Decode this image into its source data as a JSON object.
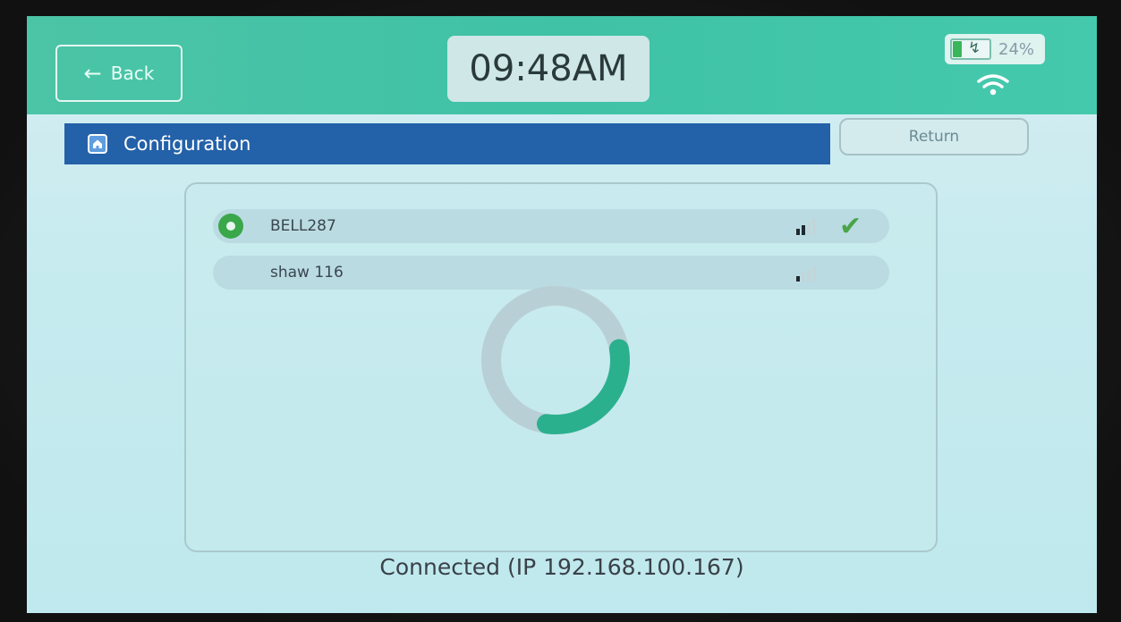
{
  "header": {
    "back_label": "Back",
    "clock": "09:48AM",
    "battery_percent": "24%",
    "battery_level": 0.24,
    "icons": [
      "back-arrow-icon",
      "battery-charging-icon",
      "wifi-icon"
    ]
  },
  "page": {
    "title": "Configuration",
    "return_label": "Return",
    "title_icon": "home-icon"
  },
  "networks": [
    {
      "name": "BELL287",
      "selected": true,
      "connected": true,
      "signal_bars": 2
    },
    {
      "name": "shaw 116",
      "selected": false,
      "connected": false,
      "signal_bars": 1
    }
  ],
  "spinner": {
    "progress": 0.3,
    "track_color": "#b9cfd6",
    "arc_color": "#2bb08e"
  },
  "status_text": "Connected (IP 192.168.100.167)",
  "colors": {
    "accent_green": "#3fc2a6",
    "title_blue": "#2361a8",
    "check_green": "#4aa54a"
  }
}
